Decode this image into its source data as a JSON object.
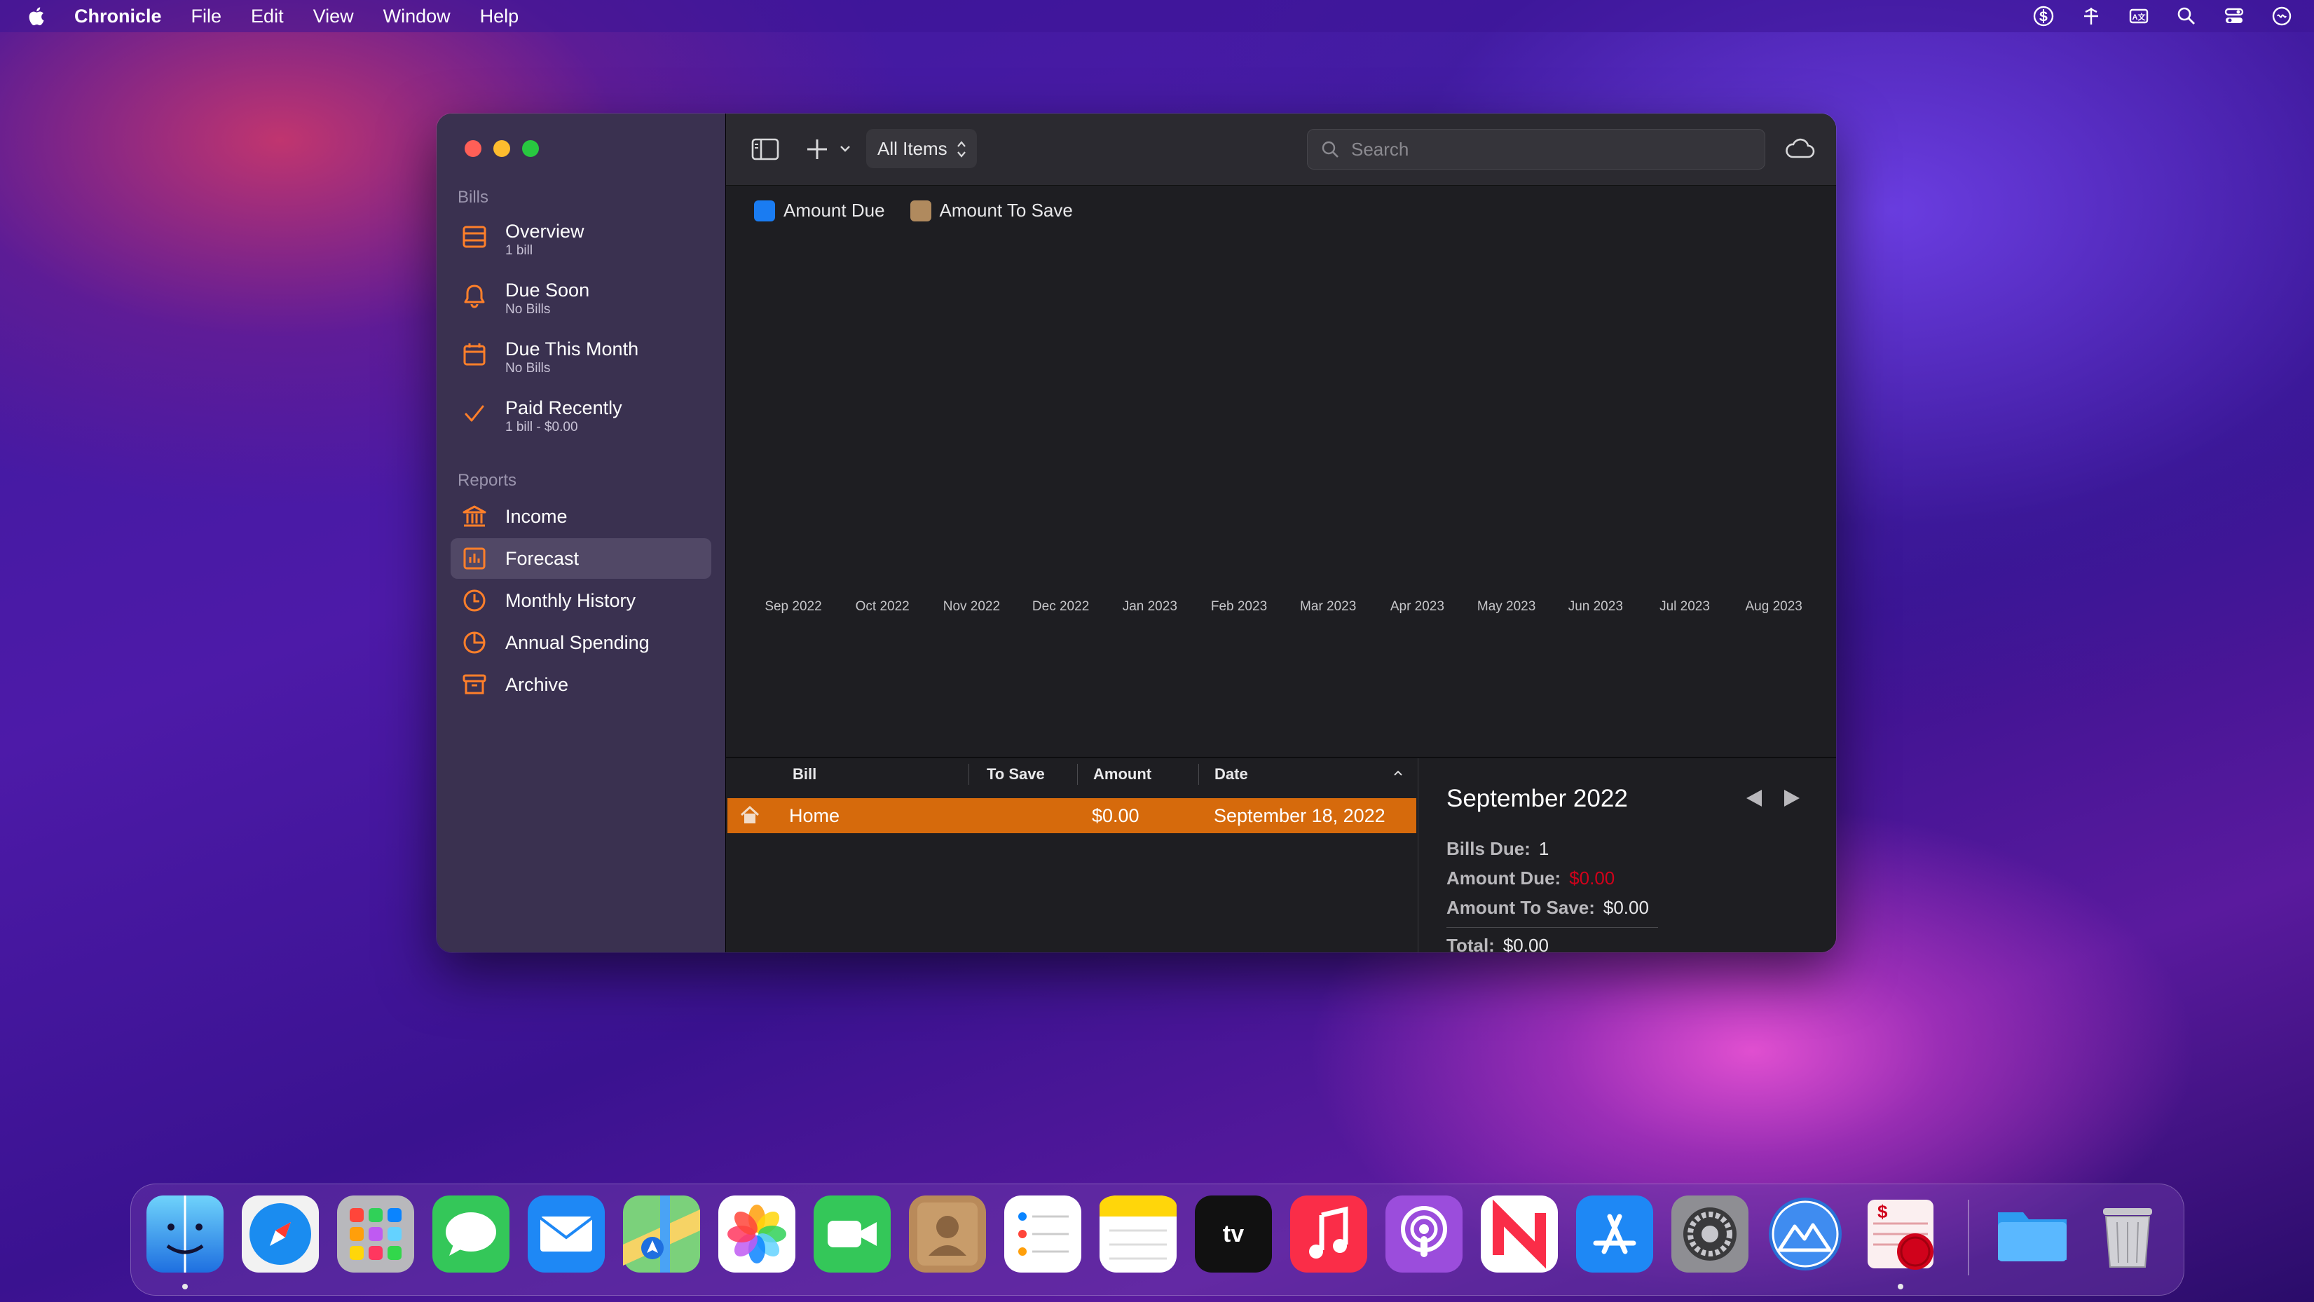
{
  "menubar": {
    "app": "Chronicle",
    "items": [
      "File",
      "Edit",
      "View",
      "Window",
      "Help"
    ]
  },
  "sidebar": {
    "bills_title": "Bills",
    "bills": [
      {
        "label": "Overview",
        "sub": "1 bill",
        "icon": "list-icon"
      },
      {
        "label": "Due Soon",
        "sub": "No Bills",
        "icon": "bell-icon"
      },
      {
        "label": "Due This Month",
        "sub": "No Bills",
        "icon": "calendar-icon"
      },
      {
        "label": "Paid Recently",
        "sub": "1 bill - $0.00",
        "icon": "checkmark-icon"
      }
    ],
    "reports_title": "Reports",
    "reports": [
      {
        "label": "Income",
        "icon": "bank-icon"
      },
      {
        "label": "Forecast",
        "icon": "bar-chart-icon",
        "selected": true
      },
      {
        "label": "Monthly History",
        "icon": "clock-icon"
      },
      {
        "label": "Annual Spending",
        "icon": "pie-chart-icon"
      },
      {
        "label": "Archive",
        "icon": "archive-box-icon"
      }
    ],
    "accent": "#ff7f2a"
  },
  "toolbar": {
    "filter": "All Items",
    "search_placeholder": "Search"
  },
  "chart": {
    "legend": [
      {
        "label": "Amount Due",
        "color": "#1a7cf2"
      },
      {
        "label": "Amount To Save",
        "color": "#b08a5e"
      }
    ],
    "months": [
      "Sep 2022",
      "Oct 2022",
      "Nov 2022",
      "Dec 2022",
      "Jan 2023",
      "Feb 2023",
      "Mar 2023",
      "Apr 2023",
      "May 2023",
      "Jun 2023",
      "Jul 2023",
      "Aug 2023"
    ]
  },
  "table": {
    "columns": [
      "Bill",
      "To Save",
      "Amount",
      "Date"
    ],
    "rows": [
      {
        "bill": "Home",
        "to_save": "",
        "amount": "$0.00",
        "date": "September 18, 2022",
        "icon": "house-icon"
      }
    ],
    "selected_color": "#d66a0c"
  },
  "detail": {
    "month": "September 2022",
    "bills_due_label": "Bills Due:",
    "bills_due": "1",
    "amount_due_label": "Amount Due:",
    "amount_due": "$0.00",
    "amount_to_save_label": "Amount To Save:",
    "amount_to_save": "$0.00",
    "total_label": "Total:",
    "total": "$0.00"
  },
  "dock": {
    "apps": [
      "Finder",
      "Safari",
      "Launchpad",
      "Messages",
      "Mail",
      "Maps",
      "Photos",
      "FaceTime",
      "Contacts",
      "Reminders",
      "Notes",
      "TV",
      "Music",
      "Podcasts",
      "News",
      "App Store",
      "System Preferences",
      "Migrator",
      "Chronicle",
      "Downloads",
      "Trash"
    ]
  }
}
